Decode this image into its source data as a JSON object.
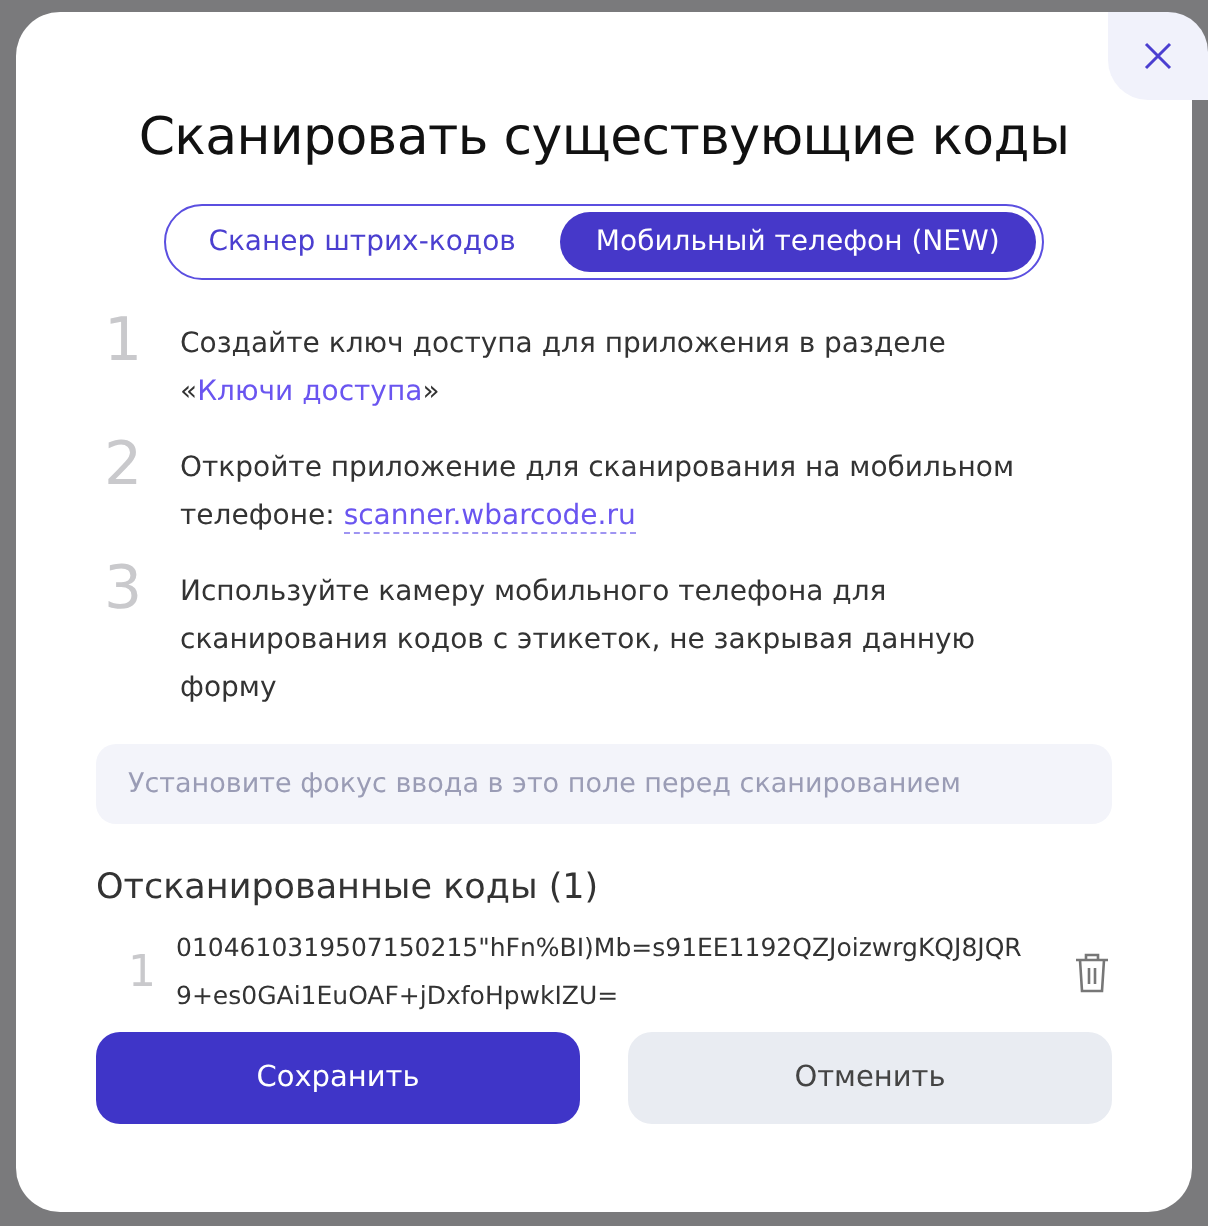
{
  "dialog": {
    "title": "Сканировать существующие коды"
  },
  "tabs": [
    {
      "label": "Сканер штрих-кодов",
      "selected": false
    },
    {
      "label": "Мобильный телефон (NEW)",
      "selected": true
    }
  ],
  "steps": [
    {
      "number": "1",
      "parts": [
        {
          "text": "Создайте ключ доступа для приложения в разделе «",
          "kind": "text"
        },
        {
          "text": "Ключи доступа",
          "kind": "link"
        },
        {
          "text": "»",
          "kind": "text"
        }
      ]
    },
    {
      "number": "2",
      "parts": [
        {
          "text": "Откройте приложение для сканирования на мобильном телефоне: ",
          "kind": "text"
        },
        {
          "text": "scanner.wbarcode.ru",
          "kind": "dotted-link"
        }
      ]
    },
    {
      "number": "3",
      "parts": [
        {
          "text": "Используйте камеру мобильного телефона для сканирования кодов с этикеток, не закрывая данную форму",
          "kind": "text"
        }
      ]
    }
  ],
  "scan_field": {
    "placeholder": "Установите фокус ввода в это поле перед сканированием"
  },
  "scanned": {
    "heading": "Отсканированные коды (1)",
    "codes": [
      {
        "number": "1",
        "code": "0104610319507150215\"hFn%BI)Mb=s91EE1192QZJoizwrgKQJ8JQR9+es0GAi1EuOAF+jDxfoHpwkIZU="
      }
    ]
  },
  "buttons": [
    {
      "label": "Сохранить",
      "kind": "primary"
    },
    {
      "label": "Отменить",
      "kind": "secondary"
    }
  ]
}
